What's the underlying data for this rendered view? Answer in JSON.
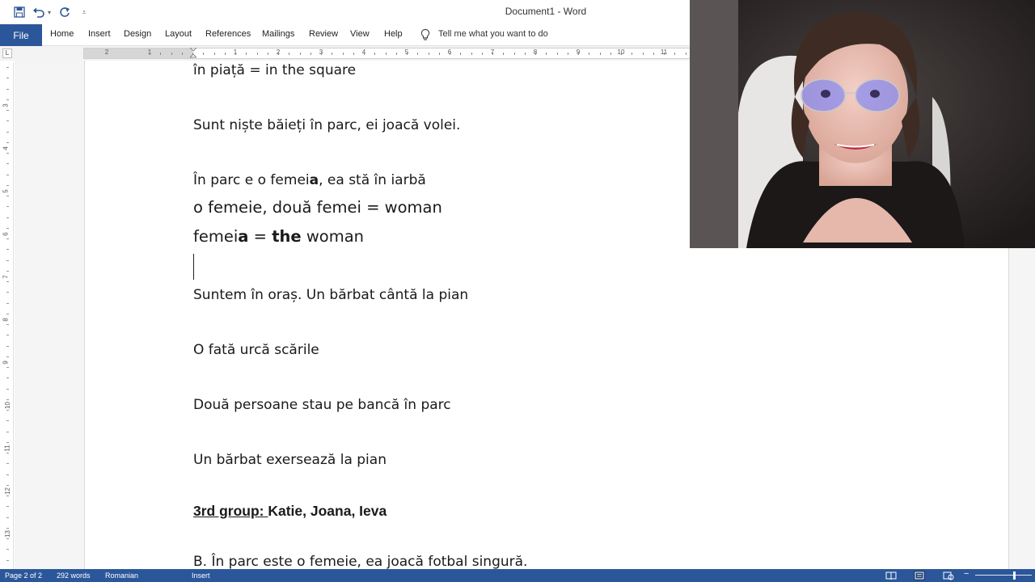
{
  "window": {
    "title": "Document1 - Word"
  },
  "quick_access": {
    "icons": [
      "save-icon",
      "undo-icon",
      "redo-icon",
      "customize-icon"
    ]
  },
  "ribbon": {
    "file_label": "File",
    "tabs": [
      {
        "label": "Home"
      },
      {
        "label": "Insert"
      },
      {
        "label": "Design"
      },
      {
        "label": "Layout"
      },
      {
        "label": "References"
      },
      {
        "label": "Mailings"
      },
      {
        "label": "Review"
      },
      {
        "label": "View"
      },
      {
        "label": "Help"
      }
    ],
    "tell_me": "Tell me what you want to do"
  },
  "ruler": {
    "h_numbers": [
      "2",
      "1",
      "1",
      "2",
      "3",
      "4",
      "5",
      "6",
      "7",
      "8",
      "9",
      "10",
      "11"
    ],
    "v_numbers": [
      "3",
      "4",
      "5",
      "6",
      "7",
      "8",
      "9",
      "10",
      "11",
      "12",
      "13"
    ]
  },
  "document": {
    "lines": {
      "l1": "în piață = in the square",
      "l2": "Sunt niște băieți în parc, ei joacă volei.",
      "l3_a": "În parc e o femei",
      "l3_b": "a",
      "l3_c": ", ea stă în iarbă",
      "l4": "o femeie, două femei = woman",
      "l5_a": "femei",
      "l5_b": "a",
      "l5_c": " = ",
      "l5_d": "the",
      "l5_e": " woman",
      "l6": "Suntem în oraș. Un bărbat cântă la pian",
      "l7": "O fată urcă scările",
      "l8": "Două persoane stau pe bancă în parc",
      "l9": "Un bărbat exersează la pian",
      "l10_a": "3rd group: ",
      "l10_b": "Katie, Joana, Ieva",
      "l11": "B. În parc este o femeie, ea joacă fotbal singură."
    }
  },
  "status": {
    "page": "Page 2 of 2",
    "words": "292 words",
    "language": "Romanian",
    "mode": "Insert",
    "views": [
      "read-mode-icon",
      "print-layout-icon",
      "web-layout-icon"
    ]
  },
  "colors": {
    "accent": "#2b579a"
  }
}
